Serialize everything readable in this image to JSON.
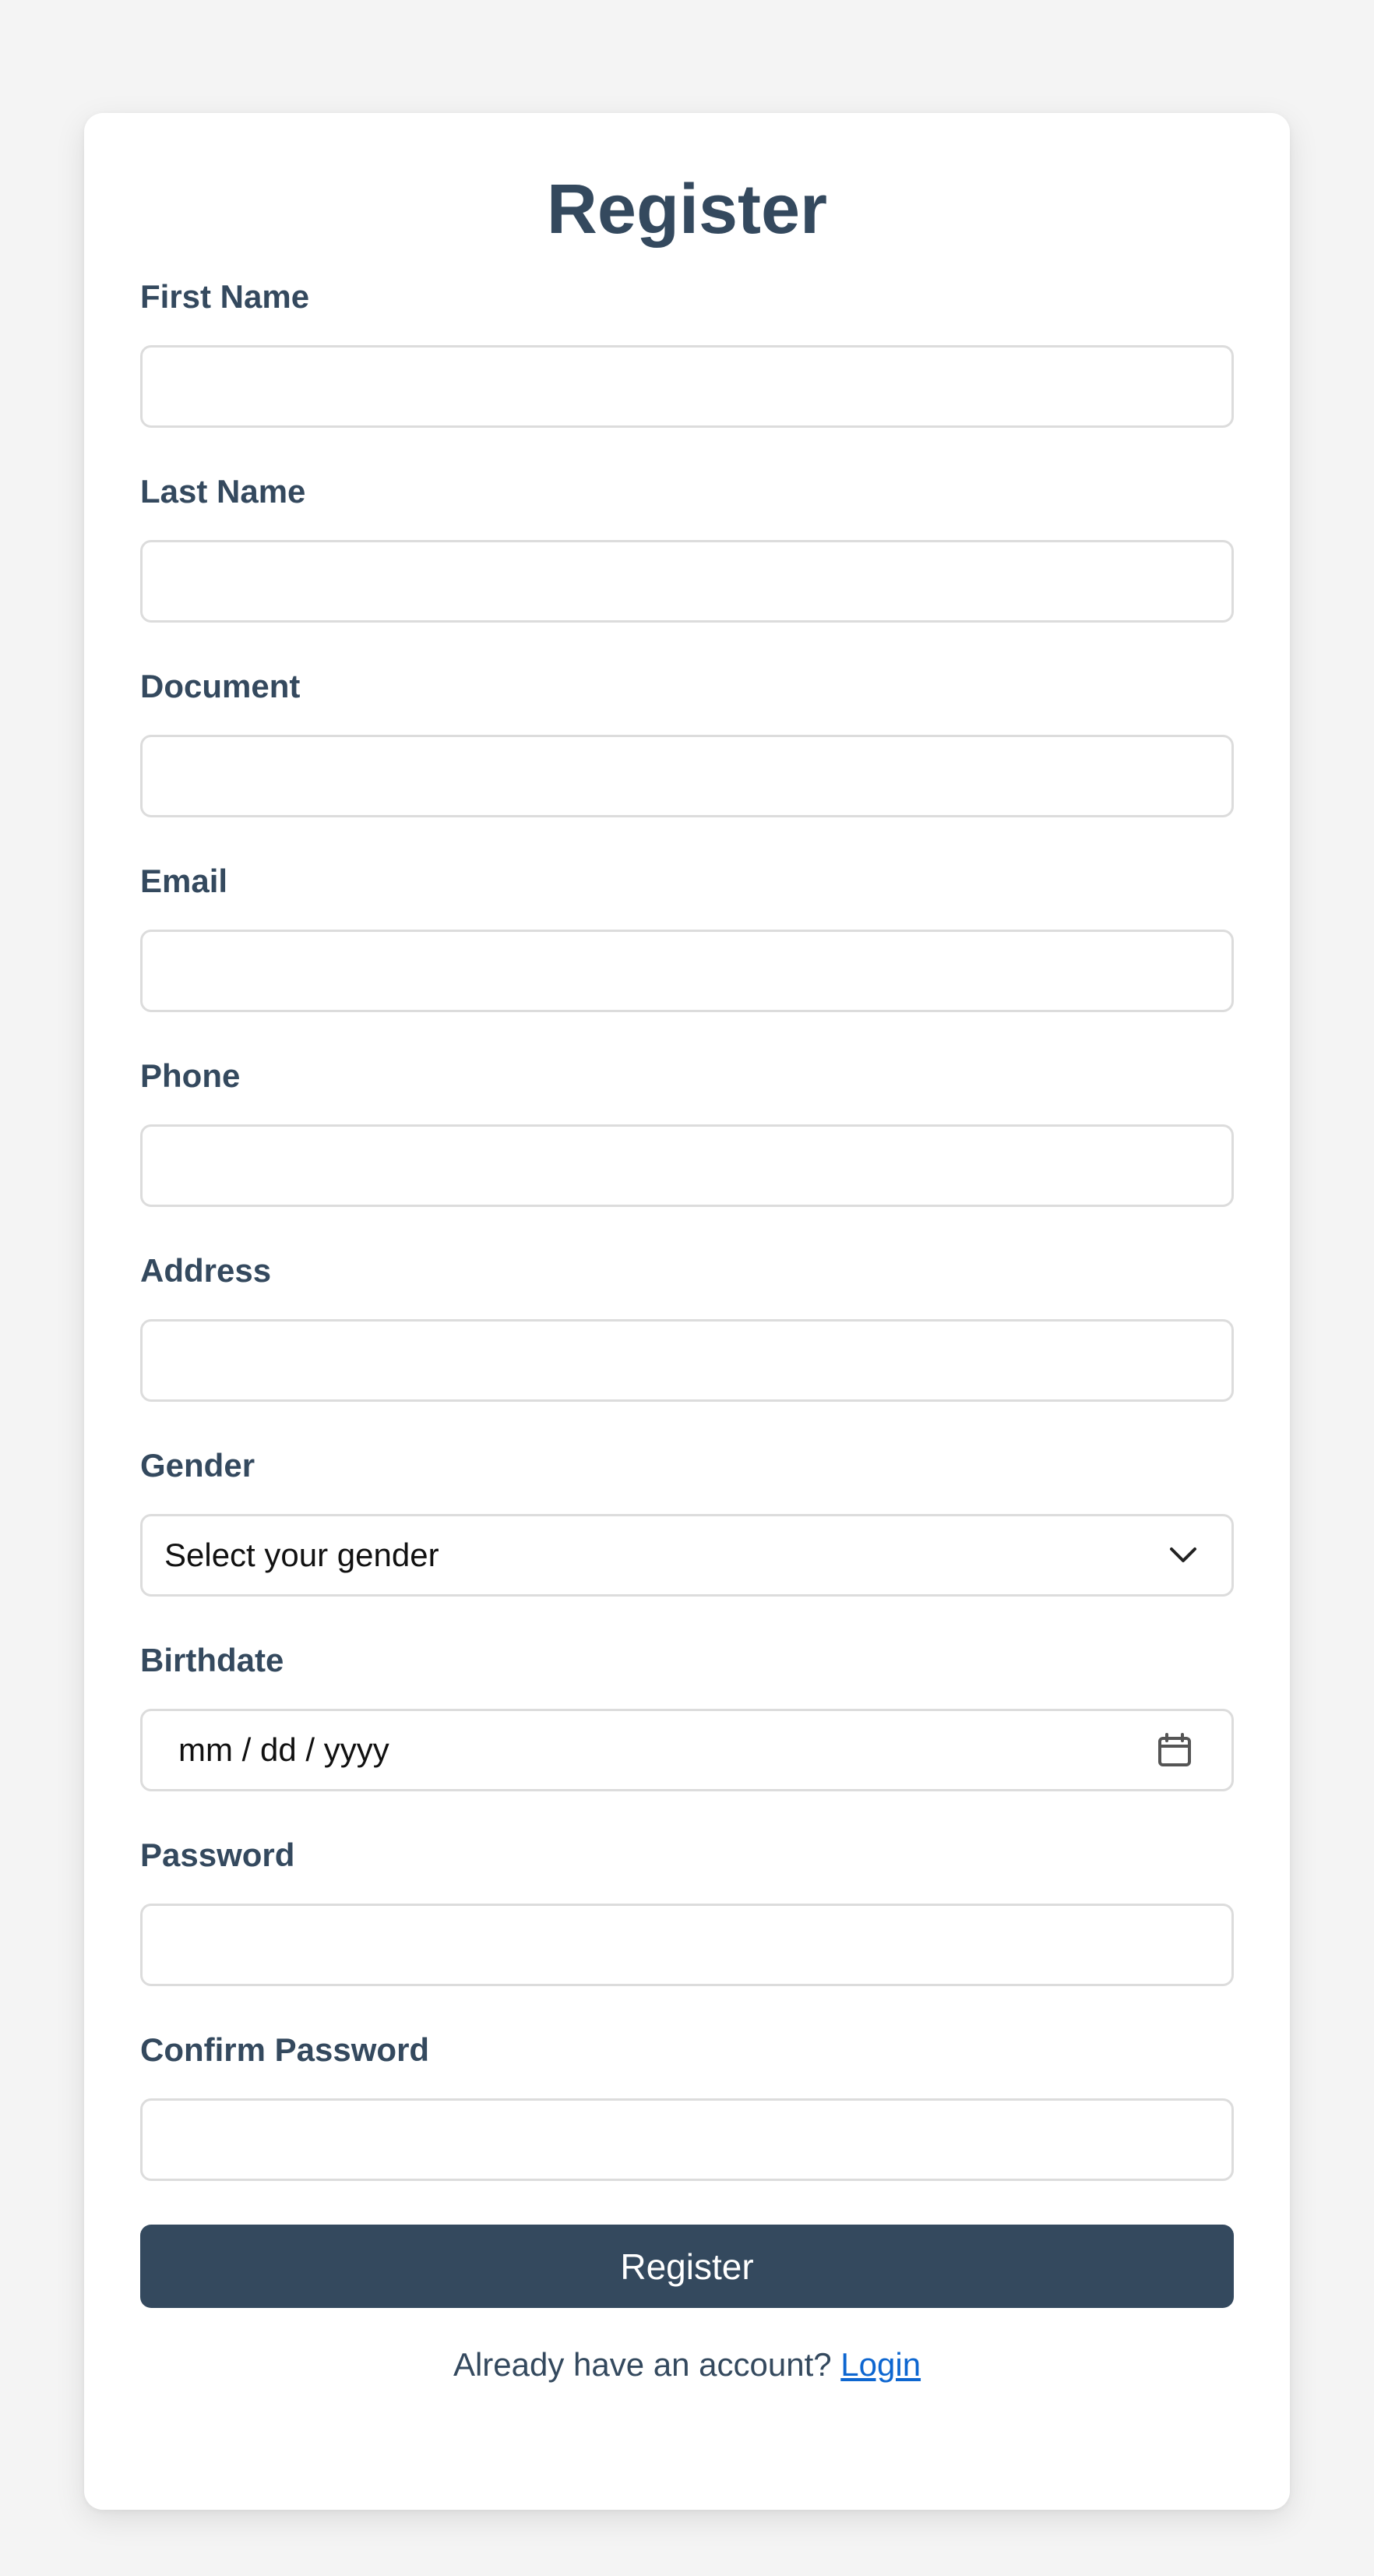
{
  "form": {
    "title": "Register",
    "fields": [
      {
        "label": "First Name",
        "type": "text",
        "value": "",
        "placeholder": ""
      },
      {
        "label": "Last Name",
        "type": "text",
        "value": "",
        "placeholder": ""
      },
      {
        "label": "Document",
        "type": "text",
        "value": "",
        "placeholder": ""
      },
      {
        "label": "Email",
        "type": "email",
        "value": "",
        "placeholder": ""
      },
      {
        "label": "Phone",
        "type": "tel",
        "value": "",
        "placeholder": ""
      },
      {
        "label": "Address",
        "type": "text",
        "value": "",
        "placeholder": ""
      },
      {
        "label": "Gender",
        "type": "select",
        "selected": "Select your gender",
        "icon": "chevron-down-icon"
      },
      {
        "label": "Birthdate",
        "type": "date",
        "display": "mm / dd / yyyy",
        "icon": "calendar-icon"
      },
      {
        "label": "Password",
        "type": "password",
        "value": "",
        "placeholder": ""
      },
      {
        "label": "Confirm Password",
        "type": "password",
        "value": "",
        "placeholder": ""
      }
    ],
    "submit_label": "Register",
    "footer_text": "Already have an account?",
    "login_link_label": "Login"
  },
  "colors": {
    "page_background": "#f4f4f4",
    "card_background": "#ffffff",
    "heading": "#34495e",
    "button_background": "#34495e",
    "button_text": "#ffffff",
    "input_border": "#dcdcdc",
    "link": "#0d66d0"
  }
}
